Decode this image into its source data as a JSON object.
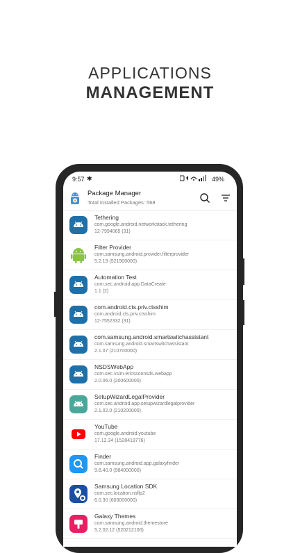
{
  "hero": {
    "line1": "APPLICATIONS",
    "line2": "MANAGEMENT"
  },
  "status_bar": {
    "time": "9:57",
    "battery": "49%"
  },
  "header": {
    "title": "Package Manager",
    "subtitle": "Total Installed Packages: 568"
  },
  "packages": [
    {
      "name": "Tethering",
      "package": "com.google.android.networkstack.tethering",
      "version": "12-7994065 (31)",
      "icon": "android-default-icon"
    },
    {
      "name": "Filter Provider",
      "package": "com.samsung.android.provider.filterprovider",
      "version": "5.2.19 (521900000)",
      "icon": "android-green-icon"
    },
    {
      "name": "Automation Test",
      "package": "com.sec.android.app.DataCreate",
      "version": "1.1 (2)",
      "icon": "android-default-icon"
    },
    {
      "name": "com.android.cts.priv.ctsshim",
      "package": "com.android.cts.priv.ctsshim",
      "version": "12-7552332 (31)",
      "icon": "android-default-icon"
    },
    {
      "name": "com.samsung.android.smartswitchassistant",
      "package": "com.samsung.android.smartswitchassistant",
      "version": "2.1.07 (210700000)",
      "icon": "android-default-icon"
    },
    {
      "name": "NSDSWebApp",
      "package": "com.sec.vsim.ericssonnsds.webapp",
      "version": "2.0.06.0 (200600000)",
      "icon": "android-default-icon"
    },
    {
      "name": "SetupWizardLegalProvider",
      "package": "com.sec.android.app.setupwizardlegalprovider",
      "version": "2.1.02.0 (210200000)",
      "icon": "android-teal-icon"
    },
    {
      "name": "YouTube",
      "package": "com.google.android.youtube",
      "version": "17.12.34 (1528419776)",
      "icon": "youtube-icon"
    },
    {
      "name": "Finder",
      "package": "com.samsung.android.app.galaxyfinder",
      "version": "9.8.40.0 (984000000)",
      "icon": "finder-icon"
    },
    {
      "name": "Samsung Location SDK",
      "package": "com.sec.location.nsflp2",
      "version": "6.0.30 (603000000)",
      "icon": "location-sdk-icon"
    },
    {
      "name": "Galaxy Themes",
      "package": "com.samsung.android.themestore",
      "version": "5.2.02.12 (520212100)",
      "icon": "galaxy-themes-icon"
    }
  ],
  "colors": {
    "android_default_bg": "#1f6fa8",
    "android_green": "#8bc34a",
    "youtube_red": "#ff0000",
    "finder_blue": "#2196f3",
    "themes_pink": "#e91e63",
    "frame": "#262626"
  }
}
